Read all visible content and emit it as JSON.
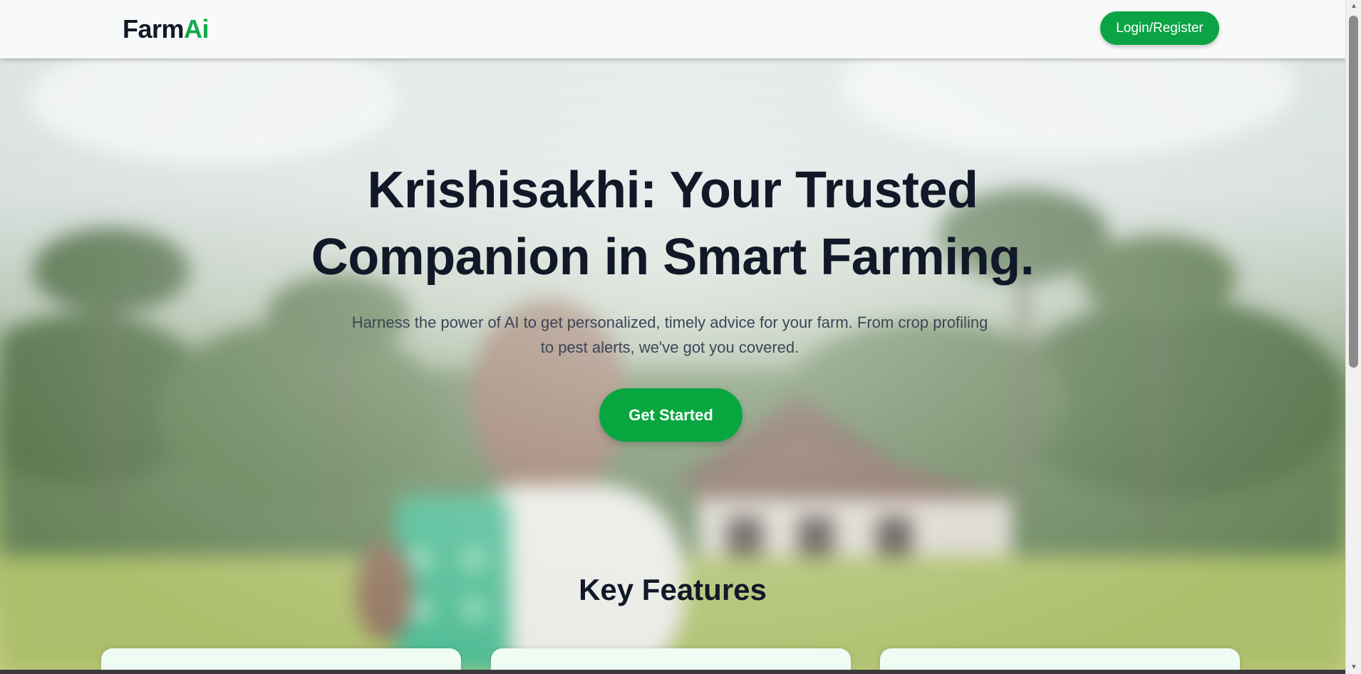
{
  "header": {
    "brand_part1": "Farm",
    "brand_part2": "Ai",
    "login_label": "Login/Register"
  },
  "hero": {
    "title_line1": "Krishisakhi: Your Trusted",
    "title_line2": "Companion in Smart Farming.",
    "subtitle_line1": "Harness the power of AI to get personalized, timely advice for your farm. From crop profiling",
    "subtitle_line2": "to pest alerts, we've got you covered.",
    "cta_label": "Get Started",
    "background_image": "blurred-farmer-with-phone-photo"
  },
  "features": {
    "title": "Key Features"
  },
  "colors": {
    "accent": "#0aa444",
    "heading": "#111827",
    "body_text": "#3b4557",
    "card_bg": "#effcf4"
  }
}
